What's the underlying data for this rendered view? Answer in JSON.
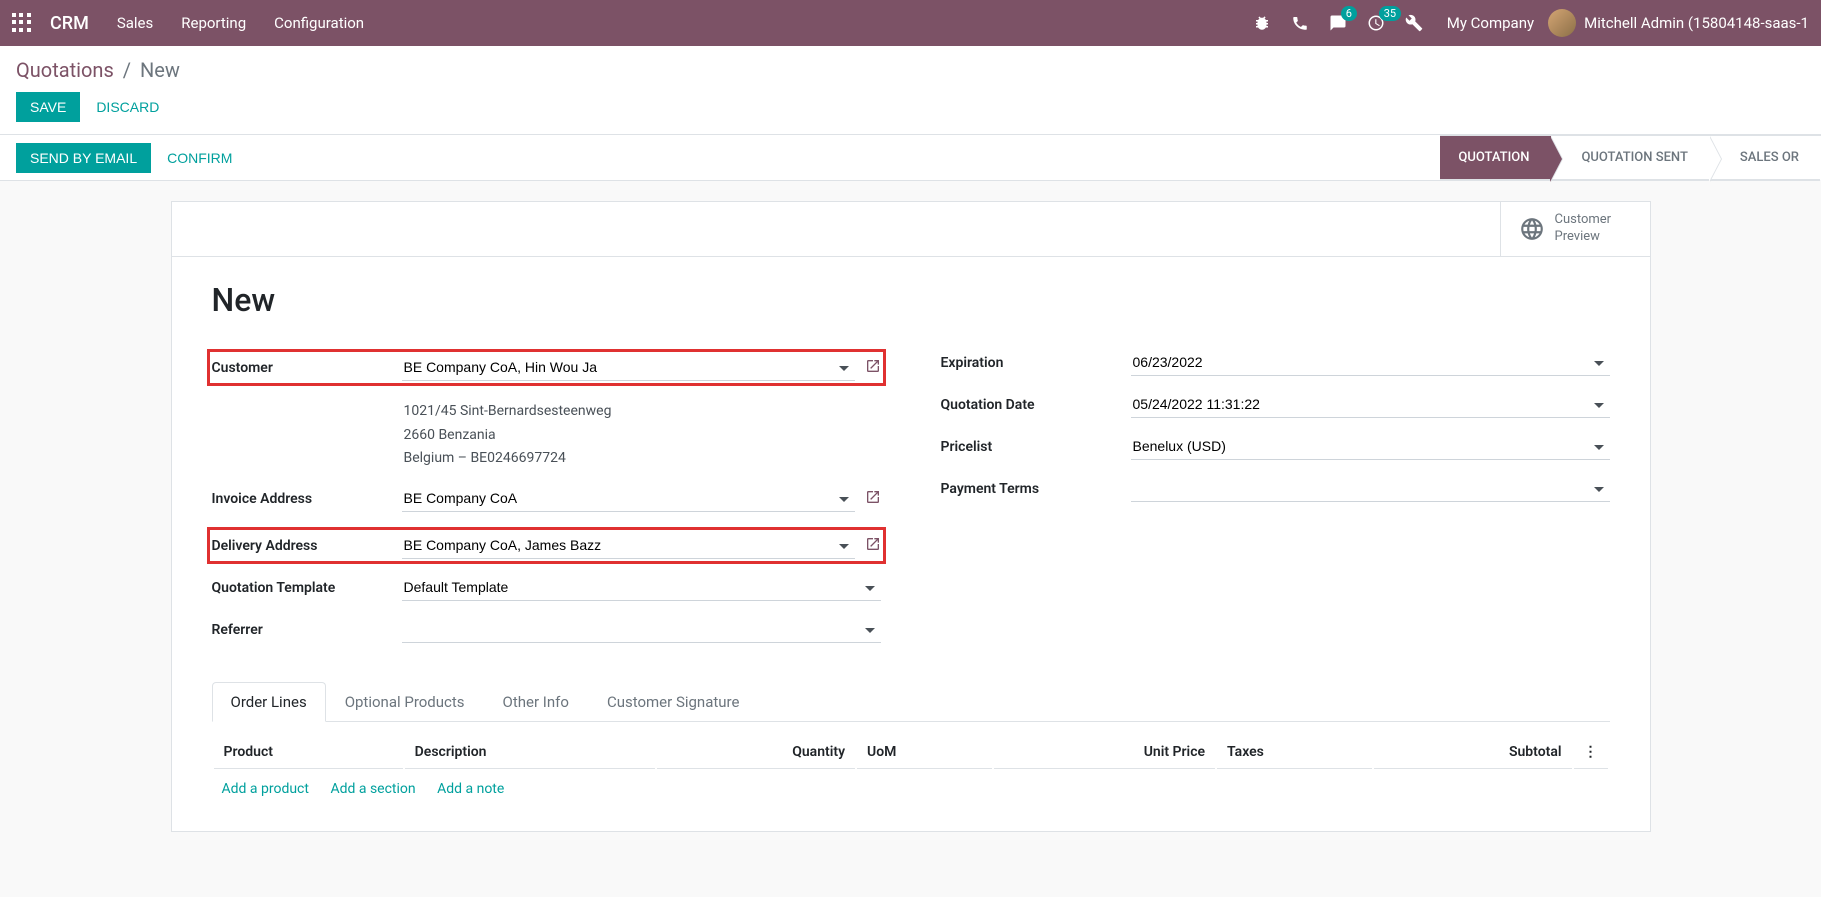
{
  "navbar": {
    "brand": "CRM",
    "menu": [
      "Sales",
      "Reporting",
      "Configuration"
    ],
    "messages_badge": "6",
    "activities_badge": "35",
    "company": "My Company",
    "user": "Mitchell Admin (15804148-saas-1"
  },
  "breadcrumb": {
    "parent": "Quotations",
    "current": "New"
  },
  "buttons": {
    "save": "SAVE",
    "discard": "DISCARD",
    "send_email": "SEND BY EMAIL",
    "confirm": "CONFIRM"
  },
  "status": {
    "steps": [
      "QUOTATION",
      "QUOTATION SENT",
      "SALES OR"
    ],
    "active_index": 0
  },
  "stat_button": {
    "line1": "Customer",
    "line2": "Preview"
  },
  "record": {
    "title": "New"
  },
  "fields": {
    "customer": {
      "label": "Customer",
      "value": "BE Company CoA, Hin Wou Ja"
    },
    "customer_address": {
      "line1": "1021/45 Sint-Bernardsesteenweg",
      "line2": "2660 Benzania",
      "line3": "Belgium – BE0246697724"
    },
    "invoice_address": {
      "label": "Invoice Address",
      "value": "BE Company CoA"
    },
    "delivery_address": {
      "label": "Delivery Address",
      "value": "BE Company CoA, James Bazz"
    },
    "quotation_template": {
      "label": "Quotation Template",
      "value": "Default Template"
    },
    "referrer": {
      "label": "Referrer",
      "value": ""
    },
    "expiration": {
      "label": "Expiration",
      "value": "06/23/2022"
    },
    "quotation_date": {
      "label": "Quotation Date",
      "value": "05/24/2022 11:31:22"
    },
    "pricelist": {
      "label": "Pricelist",
      "value": "Benelux (USD)"
    },
    "payment_terms": {
      "label": "Payment Terms",
      "value": ""
    }
  },
  "tabs": [
    "Order Lines",
    "Optional Products",
    "Other Info",
    "Customer Signature"
  ],
  "table": {
    "headers": [
      "Product",
      "Description",
      "Quantity",
      "UoM",
      "Unit Price",
      "Taxes",
      "Subtotal"
    ]
  },
  "add_links": [
    "Add a product",
    "Add a section",
    "Add a note"
  ]
}
